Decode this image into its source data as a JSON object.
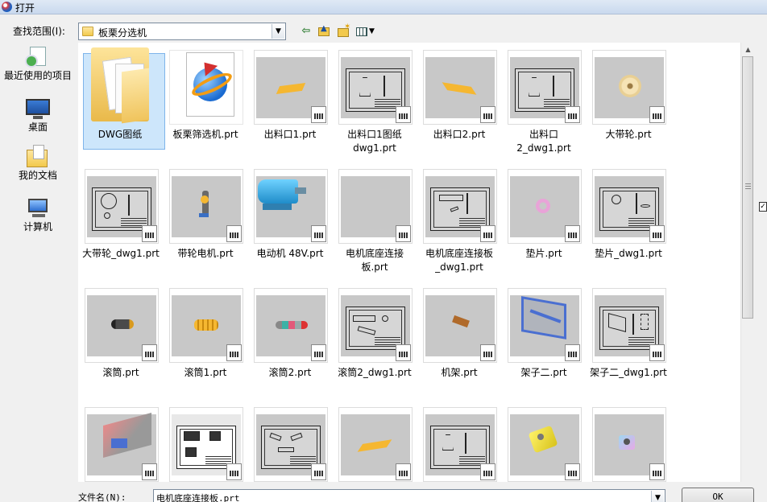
{
  "window": {
    "title": "打开"
  },
  "lookin": {
    "label": "查找范围(I):",
    "value": "板栗分选机"
  },
  "places": [
    {
      "label": "最近使用的项目",
      "icon": "recent-items-icon"
    },
    {
      "label": "桌面",
      "icon": "desktop-icon"
    },
    {
      "label": "我的文档",
      "icon": "my-documents-icon"
    },
    {
      "label": "计算机",
      "icon": "computer-icon"
    }
  ],
  "files": [
    {
      "name": "DWG图纸",
      "kind": "folder",
      "selected": true
    },
    {
      "name": "板栗筛选机.prt",
      "kind": "prt-file"
    },
    {
      "name": "出料口1.prt",
      "kind": "part"
    },
    {
      "name": "出料口1图纸dwg1.prt",
      "kind": "drawing"
    },
    {
      "name": "出料口2.prt",
      "kind": "part"
    },
    {
      "name": "出料口2_dwg1.prt",
      "kind": "drawing"
    },
    {
      "name": "大带轮.prt",
      "kind": "part"
    },
    {
      "name": "大带轮_dwg1.prt",
      "kind": "drawing"
    },
    {
      "name": "带轮电机.prt",
      "kind": "part"
    },
    {
      "name": "电动机 48V.prt",
      "kind": "part"
    },
    {
      "name": "电机底座连接板.prt",
      "kind": "part"
    },
    {
      "name": "电机底座连接板_dwg1.prt",
      "kind": "drawing"
    },
    {
      "name": "垫片.prt",
      "kind": "part"
    },
    {
      "name": "垫片_dwg1.prt",
      "kind": "drawing"
    },
    {
      "name": "滚筒.prt",
      "kind": "part"
    },
    {
      "name": "滚筒1.prt",
      "kind": "part"
    },
    {
      "name": "滚筒2.prt",
      "kind": "part"
    },
    {
      "name": "滚筒2_dwg1.prt",
      "kind": "drawing"
    },
    {
      "name": "机架.prt",
      "kind": "part"
    },
    {
      "name": "架子二.prt",
      "kind": "part"
    },
    {
      "name": "架子二_dwg1.prt",
      "kind": "drawing"
    },
    {
      "name": "",
      "kind": "part"
    },
    {
      "name": "",
      "kind": "drawing"
    },
    {
      "name": "",
      "kind": "drawing"
    },
    {
      "name": "",
      "kind": "part"
    },
    {
      "name": "",
      "kind": "drawing"
    },
    {
      "name": "",
      "kind": "part"
    },
    {
      "name": "",
      "kind": "part"
    }
  ],
  "filename": {
    "label": "文件名(N):",
    "value": "电机底座连接板.prt"
  },
  "buttons": {
    "ok": "OK"
  },
  "colors": {
    "selection": "#cde6fb",
    "part_yellow": "#f5b731",
    "thumb_gray": "#c8c8c8"
  }
}
